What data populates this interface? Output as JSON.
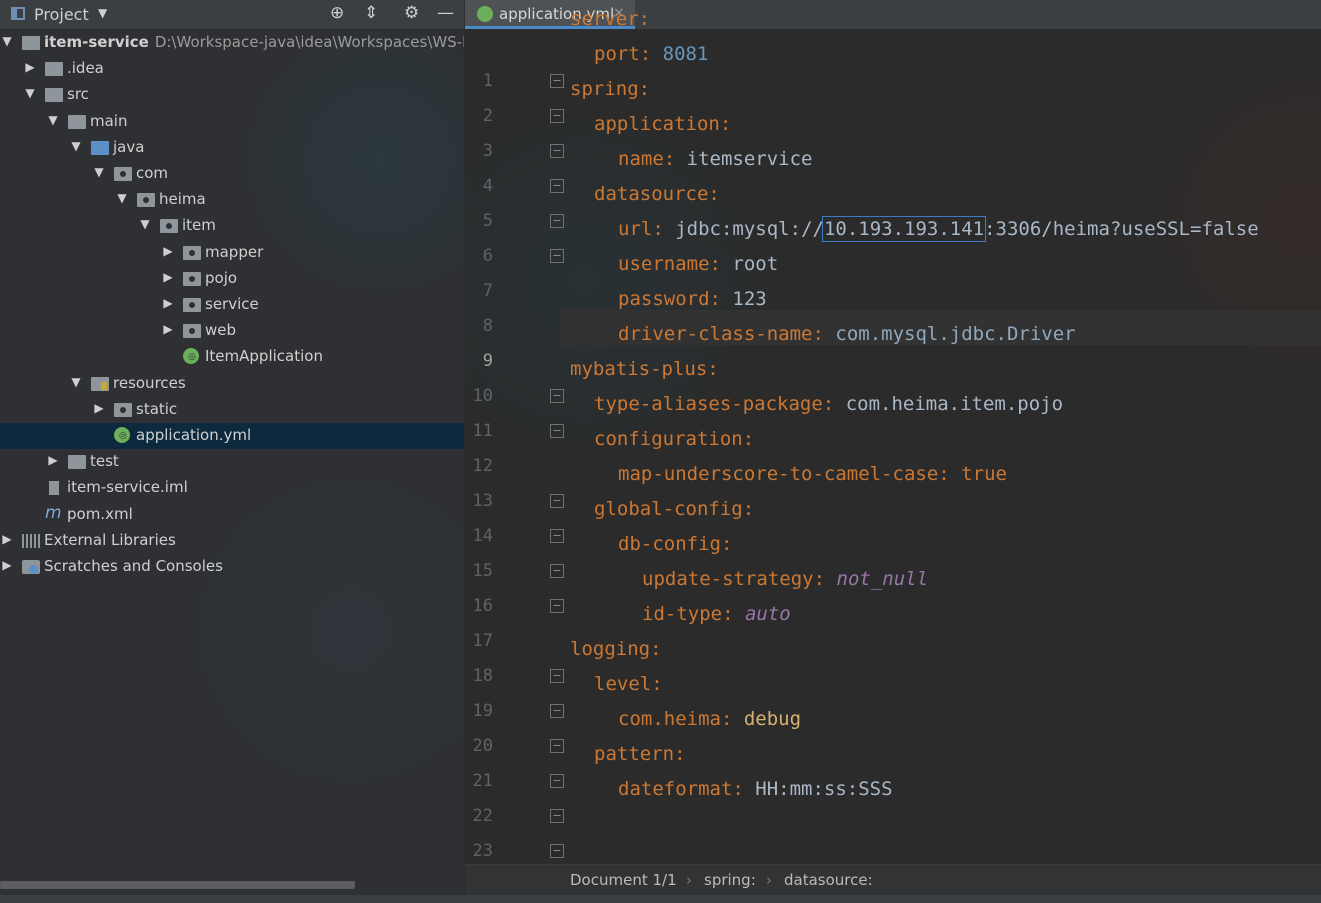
{
  "project_panel": {
    "title": "Project",
    "header_icons": [
      "locate-icon",
      "collapse-all-icon",
      "gear-icon",
      "minimize-icon"
    ],
    "tree": [
      {
        "label": "item-service",
        "hint": "D:\\Workspace-java\\idea\\Workspaces\\WS-HI",
        "depth": 0,
        "expanded": true,
        "icon": "module-folder-icon",
        "bold": true
      },
      {
        "label": ".idea",
        "depth": 1,
        "expanded": false,
        "icon": "folder-icon"
      },
      {
        "label": "src",
        "depth": 1,
        "expanded": true,
        "icon": "folder-icon"
      },
      {
        "label": "main",
        "depth": 2,
        "expanded": true,
        "icon": "folder-icon"
      },
      {
        "label": "java",
        "depth": 3,
        "expanded": true,
        "icon": "source-folder-icon"
      },
      {
        "label": "com",
        "depth": 4,
        "expanded": true,
        "icon": "package-icon"
      },
      {
        "label": "heima",
        "depth": 5,
        "expanded": true,
        "icon": "package-icon"
      },
      {
        "label": "item",
        "depth": 6,
        "expanded": true,
        "icon": "package-icon"
      },
      {
        "label": "mapper",
        "depth": 7,
        "expanded": false,
        "icon": "package-icon"
      },
      {
        "label": "pojo",
        "depth": 7,
        "expanded": false,
        "icon": "package-icon"
      },
      {
        "label": "service",
        "depth": 7,
        "expanded": false,
        "icon": "package-icon"
      },
      {
        "label": "web",
        "depth": 7,
        "expanded": false,
        "icon": "package-icon"
      },
      {
        "label": "ItemApplication",
        "depth": 7,
        "leaf": true,
        "icon": "spring-boot-class-icon"
      },
      {
        "label": "resources",
        "depth": 3,
        "expanded": true,
        "icon": "resources-folder-icon"
      },
      {
        "label": "static",
        "depth": 4,
        "expanded": false,
        "icon": "package-icon"
      },
      {
        "label": "application.yml",
        "depth": 4,
        "leaf": true,
        "icon": "spring-yml-icon",
        "selected": true
      },
      {
        "label": "test",
        "depth": 2,
        "expanded": false,
        "icon": "folder-icon"
      },
      {
        "label": "item-service.iml",
        "depth": 1,
        "leaf": true,
        "icon": "iml-file-icon"
      },
      {
        "label": "pom.xml",
        "depth": 1,
        "leaf": true,
        "icon": "maven-icon"
      },
      {
        "label": "External Libraries",
        "depth": 0,
        "expanded": false,
        "icon": "libraries-icon"
      },
      {
        "label": "Scratches and Consoles",
        "depth": 0,
        "expanded": false,
        "icon": "scratches-icon"
      }
    ]
  },
  "editor": {
    "tab": {
      "label": "application.yml",
      "close": "×"
    },
    "current_line": 9,
    "lines": [
      {
        "n": "1",
        "indent": 0,
        "key": "server",
        "sep": ":",
        "val": "",
        "vtype": "none"
      },
      {
        "n": "2",
        "indent": 1,
        "key": "port",
        "sep": ":",
        "val": "8081",
        "vtype": "num"
      },
      {
        "n": "3",
        "indent": 0,
        "key": "spring",
        "sep": ":",
        "val": "",
        "vtype": "none"
      },
      {
        "n": "4",
        "indent": 1,
        "key": "application",
        "sep": ":",
        "val": "",
        "vtype": "none"
      },
      {
        "n": "5",
        "indent": 2,
        "key": "name",
        "sep": ":",
        "val": "itemservice",
        "vtype": "v"
      },
      {
        "n": "6",
        "indent": 1,
        "key": "datasource",
        "sep": ":",
        "val": "",
        "vtype": "none"
      },
      {
        "n": "7",
        "indent": 2,
        "key": "url",
        "sep": ":",
        "val_pre": "jdbc:mysql://",
        "val_sel": "10.193.193.141",
        "val_post": ":3306/heima?useSSL=false",
        "vtype": "url"
      },
      {
        "n": "8",
        "indent": 2,
        "key": "username",
        "sep": ":",
        "val": "root",
        "vtype": "v"
      },
      {
        "n": "9",
        "indent": 2,
        "key": "password",
        "sep": ":",
        "val": "123",
        "vtype": "v"
      },
      {
        "n": "10",
        "indent": 2,
        "key": "driver-class-name",
        "sep": ":",
        "val": "com.mysql.jdbc.Driver",
        "vtype": "pkgv"
      },
      {
        "n": "11",
        "indent": 0,
        "key": "mybatis-plus",
        "sep": ":",
        "val": "",
        "vtype": "none"
      },
      {
        "n": "12",
        "indent": 1,
        "key": "type-aliases-package",
        "sep": ":",
        "val": "com.heima.item.pojo",
        "vtype": "v"
      },
      {
        "n": "13",
        "indent": 1,
        "key": "configuration",
        "sep": ":",
        "val": "",
        "vtype": "none"
      },
      {
        "n": "14",
        "indent": 2,
        "key": "map-underscore-to-camel-case",
        "sep": ":",
        "val": "true",
        "vtype": "bool"
      },
      {
        "n": "15",
        "indent": 1,
        "key": "global-config",
        "sep": ":",
        "val": "",
        "vtype": "none"
      },
      {
        "n": "16",
        "indent": 2,
        "key": "db-config",
        "sep": ":",
        "val": "",
        "vtype": "none"
      },
      {
        "n": "17",
        "indent": 3,
        "key": "update-strategy",
        "sep": ":",
        "val": "not_null",
        "vtype": "en"
      },
      {
        "n": "18",
        "indent": 3,
        "key": "id-type",
        "sep": ":",
        "val": "auto",
        "vtype": "en"
      },
      {
        "n": "19",
        "indent": 0,
        "key": "logging",
        "sep": ":",
        "val": "",
        "vtype": "none"
      },
      {
        "n": "20",
        "indent": 1,
        "key": "level",
        "sep": ":",
        "val": "",
        "vtype": "none"
      },
      {
        "n": "21",
        "indent": 2,
        "key": "com.heima",
        "sep": ":",
        "val": "debug",
        "vtype": "vb"
      },
      {
        "n": "22",
        "indent": 1,
        "key": "pattern",
        "sep": ":",
        "val": "",
        "vtype": "none"
      },
      {
        "n": "23",
        "indent": 2,
        "key": "dateformat",
        "sep": ":",
        "val": "HH:mm:ss:SSS",
        "vtype": "v"
      }
    ]
  },
  "breadcrumb": {
    "items": [
      "Document 1/1",
      "spring:",
      "datasource:"
    ],
    "separator": "›"
  },
  "colors": {
    "key": "#cc7832",
    "number": "#6897bb",
    "string": "#a9b7c6",
    "enum": "#9876aa",
    "selection_outline": "#3b7bc7",
    "selected_row": "#0d293e"
  }
}
